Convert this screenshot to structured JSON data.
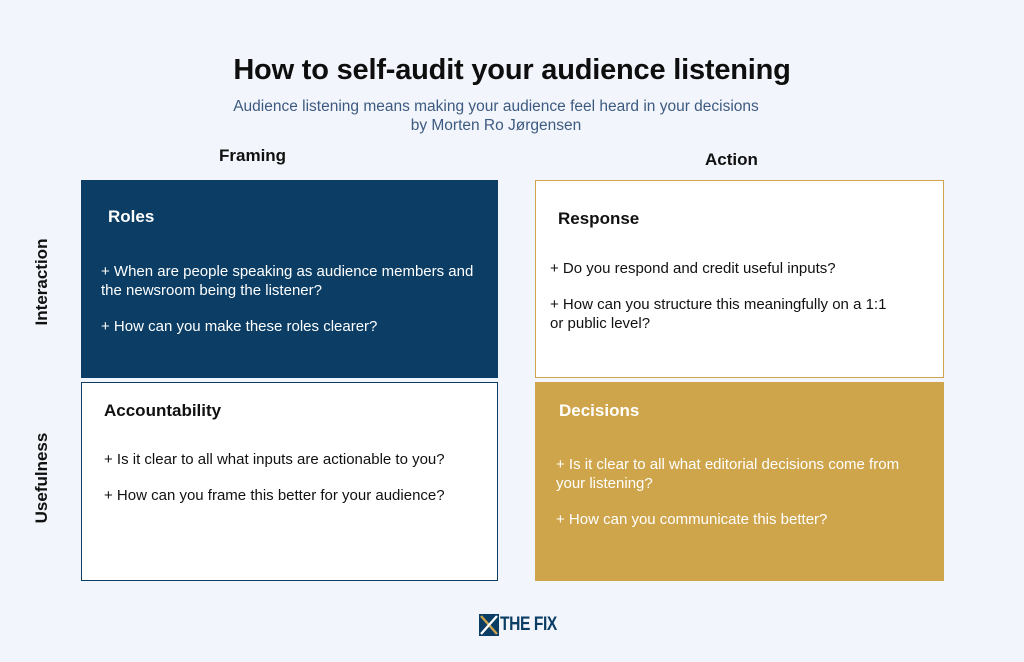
{
  "title": "How to self-audit your audience listening",
  "subtitle_line1": "Audience listening means making your audience feel heard in your decisions",
  "subtitle_line2": "by Morten Ro Jørgensen",
  "columns": {
    "framing": "Framing",
    "action": "Action"
  },
  "rows": {
    "interaction": "Interaction",
    "usefulness": "Usefulness"
  },
  "cards": {
    "roles": {
      "title": "Roles",
      "items": [
        "+ When are people speaking as audience members and the newsroom being the listener?",
        "+ How can you make these roles clearer?"
      ]
    },
    "response": {
      "title": "Response",
      "items": [
        "+ Do you respond and credit useful inputs?",
        "+ How can you structure this meaningfully on a 1:1 or public level?"
      ]
    },
    "accountability": {
      "title": "Accountability",
      "items": [
        "+ Is it clear to all what inputs are actionable to you?",
        "+ How can you frame this better for your audience?"
      ]
    },
    "decisions": {
      "title": "Decisions",
      "items": [
        "+ Is it clear to all what editorial decisions come from your listening?",
        "+ How can you communicate this better?"
      ]
    }
  },
  "logo": {
    "text": "THE FIX",
    "icon": "the-fix-logo-mark"
  },
  "colors": {
    "navy": "#0b3d65",
    "gold": "#cfa54b",
    "background": "#f2f5fb"
  }
}
